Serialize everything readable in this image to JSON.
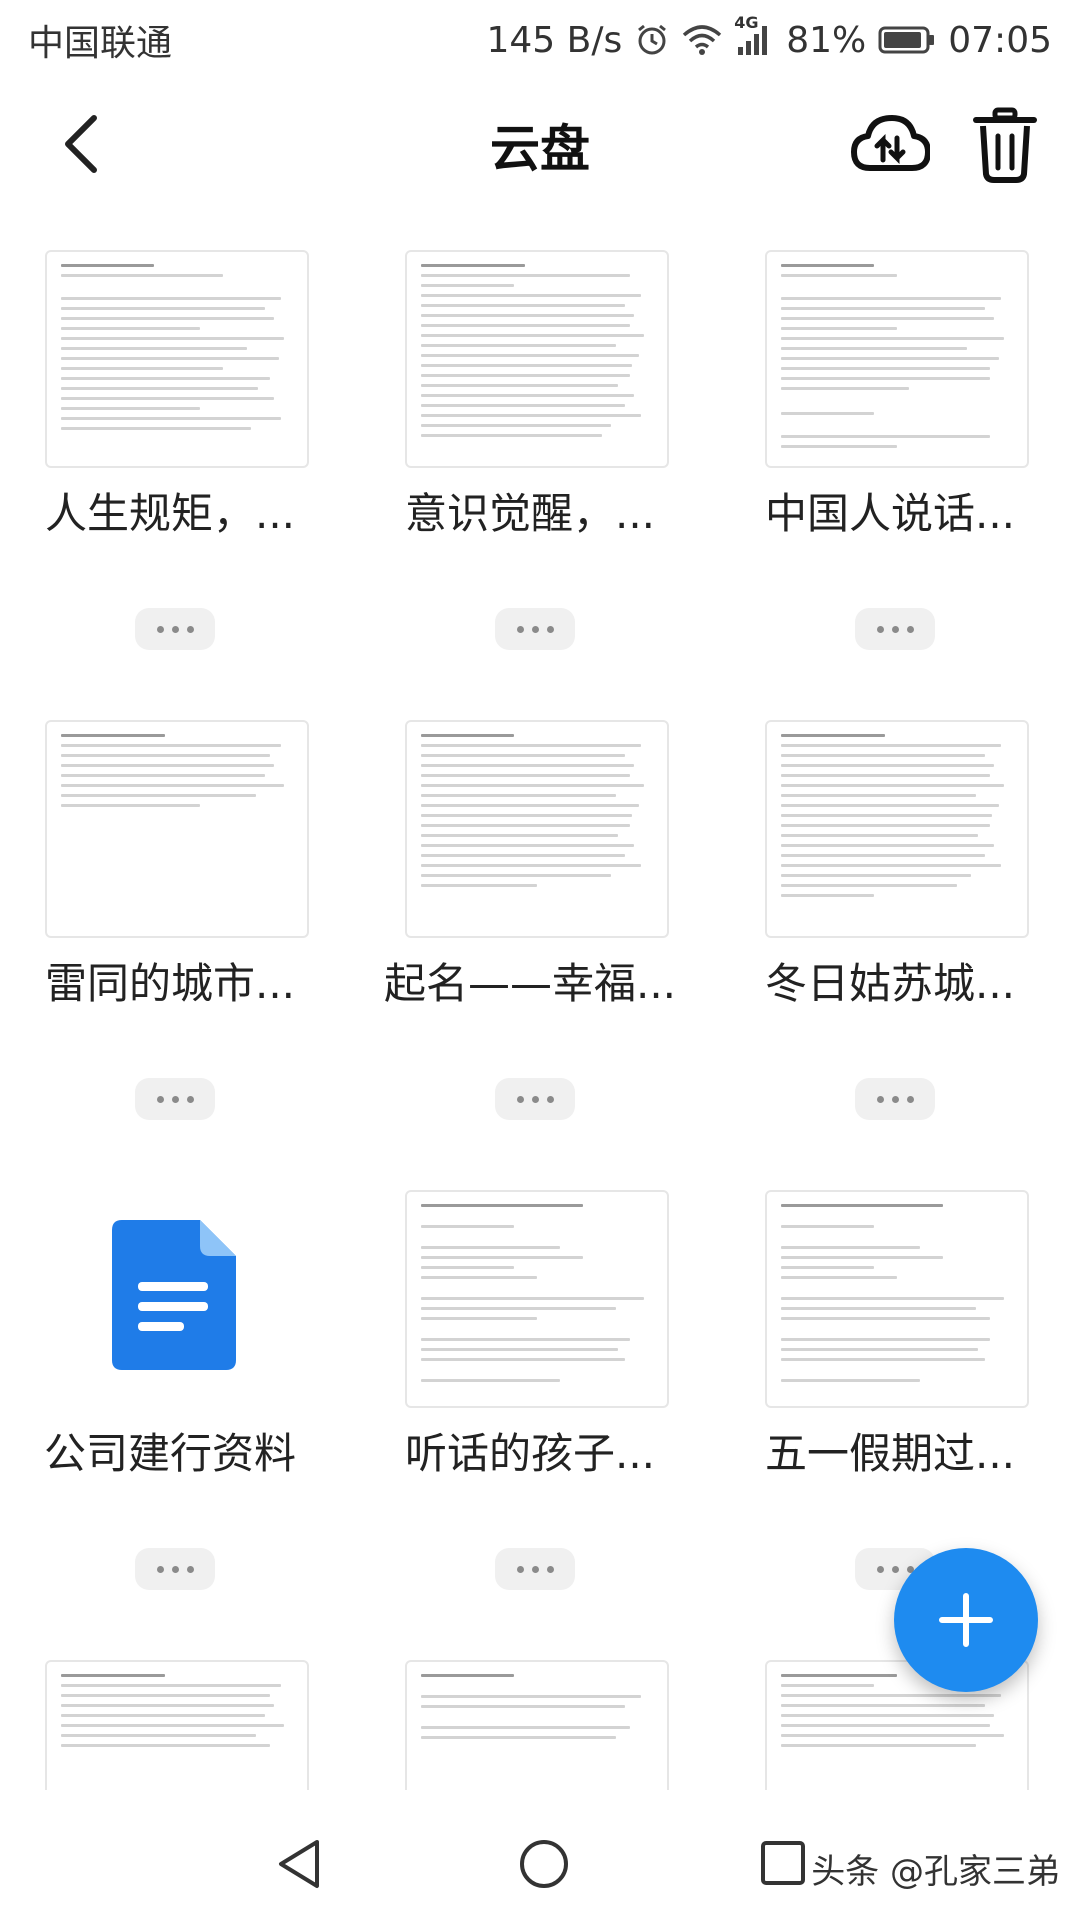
{
  "status_bar": {
    "carrier": "中国联通",
    "speed": "145 B/s",
    "network": "4G",
    "battery": "81%",
    "time": "07:05",
    "icons": [
      "alarm-icon",
      "wifi-icon",
      "signal-icon",
      "battery-icon"
    ]
  },
  "header": {
    "title": "云盘",
    "icons": [
      "back-icon",
      "cloud-upload-icon",
      "trash-icon"
    ]
  },
  "files": [
    {
      "name": "人生规矩，...",
      "type": "document-preview"
    },
    {
      "name": "意识觉醒，...",
      "type": "document-preview"
    },
    {
      "name": "中国人说话...",
      "type": "document-preview"
    },
    {
      "name": "雷同的城市...",
      "type": "document-preview"
    },
    {
      "name": "起名——幸福...",
      "type": "document-preview"
    },
    {
      "name": "冬日姑苏城...",
      "type": "document-preview"
    },
    {
      "name": "公司建行资料",
      "type": "doc-icon"
    },
    {
      "name": "听话的孩子...",
      "type": "document-preview"
    },
    {
      "name": "五一假期过...",
      "type": "document-preview"
    },
    {
      "name": "",
      "type": "document-preview"
    },
    {
      "name": "",
      "type": "document-preview"
    },
    {
      "name": "",
      "type": "document-preview"
    }
  ],
  "fab": {
    "icon": "plus-icon"
  },
  "nav": {
    "icons": [
      "nav-back-icon",
      "nav-home-icon",
      "nav-recent-icon"
    ]
  },
  "watermark": "头条 @孔家三弟",
  "colors": {
    "accent": "#1e8bf0",
    "doc_blue": "#1f7ce8",
    "background": "#ffffff"
  }
}
